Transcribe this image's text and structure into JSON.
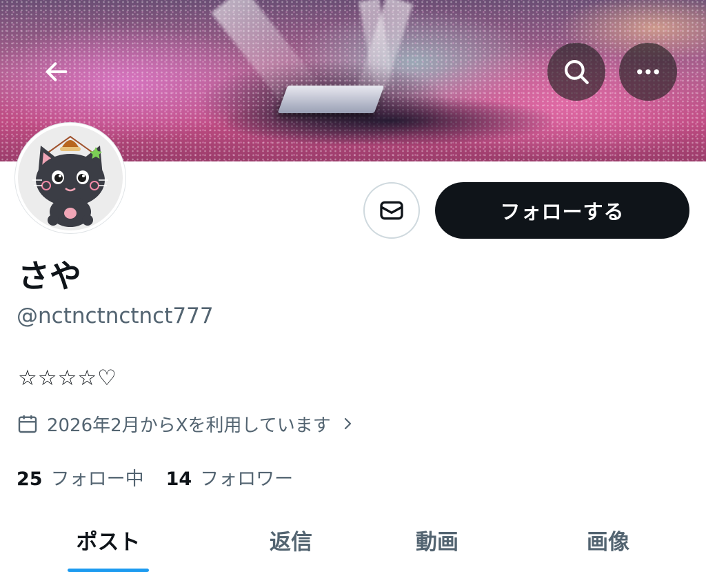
{
  "profile": {
    "display_name": "さや",
    "handle": "@nctnctnctnct777",
    "bio": "☆☆☆☆♡",
    "joined": "2026年2月からXを利用しています"
  },
  "actions": {
    "follow_label": "フォローする"
  },
  "stats": {
    "following_count": "25",
    "following_label": "フォロー中",
    "followers_count": "14",
    "followers_label": "フォロワー"
  },
  "tabs": [
    {
      "label": "ポスト",
      "active": true
    },
    {
      "label": "返信",
      "active": false
    },
    {
      "label": "動画",
      "active": false
    },
    {
      "label": "画像",
      "active": false
    }
  ],
  "icons": {
    "back": "arrow-left-icon",
    "search": "search-icon",
    "more": "more-horizontal-icon",
    "message": "envelope-icon",
    "calendar": "calendar-icon",
    "chevron": "chevron-right-icon"
  },
  "colors": {
    "primary_text": "#0f1419",
    "secondary_text": "#536471",
    "follow_button_bg": "#0f1419",
    "tab_indicator": "#1d9bf0"
  }
}
